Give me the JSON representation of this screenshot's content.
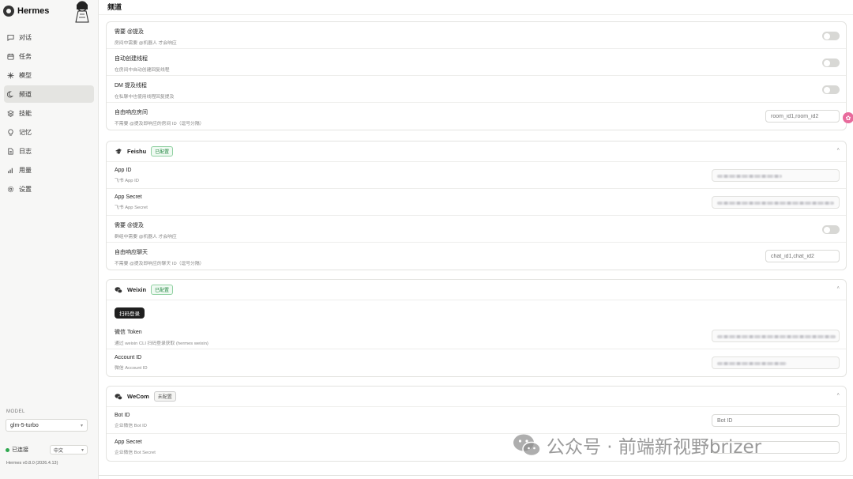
{
  "app": {
    "title": "Hermes"
  },
  "page": {
    "title": "频道"
  },
  "sidebar": {
    "items": [
      {
        "label": "对话",
        "icon": "chat-icon"
      },
      {
        "label": "任务",
        "icon": "calendar-icon"
      },
      {
        "label": "模型",
        "icon": "sparkle-icon"
      },
      {
        "label": "频道",
        "icon": "moon-icon",
        "active": true
      },
      {
        "label": "技能",
        "icon": "layers-icon"
      },
      {
        "label": "记忆",
        "icon": "bulb-icon"
      },
      {
        "label": "日志",
        "icon": "file-icon"
      },
      {
        "label": "用量",
        "icon": "bar-chart-icon"
      },
      {
        "label": "设置",
        "icon": "gear-icon"
      }
    ],
    "model_label": "MODEL",
    "model_value": "glm-5-turbo",
    "status": "已连接",
    "language": "中文",
    "version": "Hermes v0.8.0 (2026.4.13)"
  },
  "matrix_card": {
    "rows": [
      {
        "title": "需要 @提及",
        "desc": "房间中需要 @机器人 才会响应",
        "control": "toggle",
        "on": false
      },
      {
        "title": "自动创建线程",
        "desc": "在房间中自动创建回复线程",
        "control": "toggle",
        "on": false
      },
      {
        "title": "DM 提及线程",
        "desc": "在私聊中也使用线程回复提及",
        "control": "toggle",
        "on": false
      },
      {
        "title": "自由响应房间",
        "desc": "不需要 @提及即响应的房间 ID（逗号分隔）",
        "control": "input",
        "placeholder": "room_id1,room_id2"
      }
    ]
  },
  "feishu": {
    "name": "Feishu",
    "badge": "已配置",
    "rows": [
      {
        "title": "App ID",
        "desc": "飞书 App ID",
        "control": "masked"
      },
      {
        "title": "App Secret",
        "desc": "飞书 App Secret",
        "control": "masked"
      },
      {
        "title": "需要 @提及",
        "desc": "群组中需要 @机器人 才会响应",
        "control": "toggle",
        "on": false
      },
      {
        "title": "自由响应聊天",
        "desc": "不需要 @提及即响应的聊天 ID（逗号分隔）",
        "control": "input",
        "placeholder": "chat_id1,chat_id2"
      }
    ]
  },
  "weixin": {
    "name": "Weixin",
    "badge": "已配置",
    "qr_button": "扫码登录",
    "rows": [
      {
        "title": "微信 Token",
        "desc": "通过 weixin CLI 扫码登录获取 (hermes weixin)",
        "control": "masked"
      },
      {
        "title": "Account ID",
        "desc": "微信 Account ID",
        "control": "masked"
      }
    ]
  },
  "wecom": {
    "name": "WeCom",
    "badge": "未配置",
    "rows": [
      {
        "title": "Bot ID",
        "desc": "企业微信 Bot ID",
        "control": "input",
        "placeholder": "Bot ID"
      },
      {
        "title": "App Secret",
        "desc": "企业微信 Bot Secret",
        "control": "input",
        "placeholder": ""
      }
    ]
  },
  "watermark": {
    "text": "公众号 · 前端新视野brizer"
  },
  "colors": {
    "accent_green": "#2fa84f",
    "active_nav_bg": "#e4e4e1",
    "badge_pink": "#e86a9c"
  }
}
